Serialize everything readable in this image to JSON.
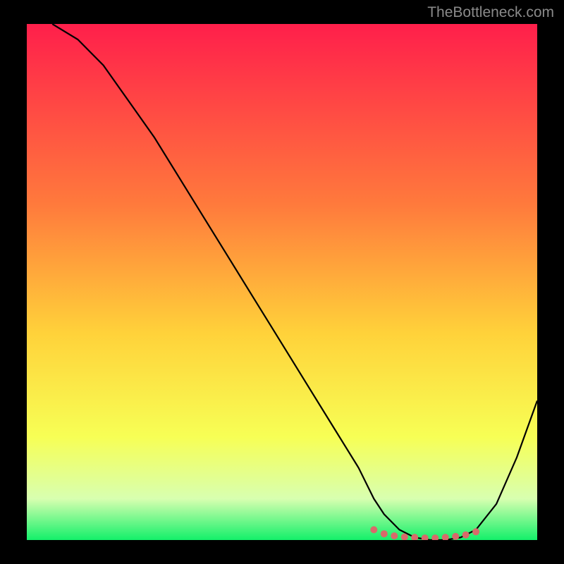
{
  "attribution": "TheBottleneck.com",
  "chart_data": {
    "type": "line",
    "title": "",
    "xlabel": "",
    "ylabel": "",
    "x_range": [
      0,
      100
    ],
    "y_range": [
      0,
      100
    ],
    "gradient_stops": [
      {
        "offset": 0,
        "color": "#ff1f4b"
      },
      {
        "offset": 35,
        "color": "#ff7a3c"
      },
      {
        "offset": 60,
        "color": "#ffd23a"
      },
      {
        "offset": 80,
        "color": "#f7ff55"
      },
      {
        "offset": 92,
        "color": "#d8ffb0"
      },
      {
        "offset": 100,
        "color": "#13f06a"
      }
    ],
    "series": [
      {
        "name": "bottleneck-curve",
        "color": "#000000",
        "x": [
          5,
          10,
          15,
          20,
          25,
          30,
          35,
          40,
          45,
          50,
          55,
          60,
          65,
          68,
          70,
          73,
          76,
          79,
          82,
          85,
          88,
          92,
          96,
          100
        ],
        "y": [
          100,
          97,
          92,
          85,
          78,
          70,
          62,
          54,
          46,
          38,
          30,
          22,
          14,
          8,
          5,
          2,
          0.5,
          0,
          0,
          0.5,
          2,
          7,
          16,
          27
        ]
      }
    ],
    "markers": {
      "name": "flat-region",
      "color": "#d86a6a",
      "x": [
        68,
        70,
        72,
        74,
        76,
        78,
        80,
        82,
        84,
        86,
        88
      ],
      "y": [
        2,
        1.2,
        0.8,
        0.6,
        0.5,
        0.4,
        0.4,
        0.5,
        0.7,
        1.0,
        1.6
      ]
    }
  }
}
